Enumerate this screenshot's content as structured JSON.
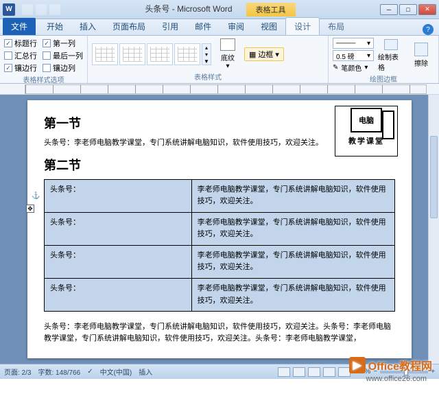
{
  "title": "头条号 - Microsoft Word",
  "contextTab": "表格工具",
  "tabs": {
    "file": "文件",
    "home": "开始",
    "insert": "插入",
    "layout": "页面布局",
    "references": "引用",
    "mailings": "邮件",
    "review": "审阅",
    "view": "视图",
    "design": "设计",
    "tblLayout": "布局"
  },
  "ribbon": {
    "options": {
      "headerRow": "标题行",
      "firstCol": "第一列",
      "totalRow": "汇总行",
      "lastCol": "最后一列",
      "bandedRow": "镶边行",
      "bandedCol": "镶边列",
      "groupLabel": "表格样式选项"
    },
    "styles": {
      "shading": "底纹",
      "border": "边框",
      "groupLabel": "表格样式"
    },
    "borders": {
      "weight": "0.5 磅",
      "penColor": "笔颜色",
      "draw": "绘制表格",
      "erase": "擦除",
      "groupLabel": "绘图边框"
    }
  },
  "doc": {
    "section1": "第一节",
    "para1": "头条号：李老师电脑教学课堂，专门系统讲解电脑知识，软件使用技巧，欢迎关注。",
    "section2": "第二节",
    "illus": {
      "line1": "电脑",
      "line2": "教学课堂"
    },
    "table": {
      "rows": [
        {
          "c1": "头条号：",
          "c2": "李老师电脑教学课堂，专门系统讲解电脑知识，软件使用技巧，欢迎关注。"
        },
        {
          "c1": "头条号：",
          "c2": "李老师电脑教学课堂，专门系统讲解电脑知识，软件使用技巧，欢迎关注。"
        },
        {
          "c1": "头条号：",
          "c2": "李老师电脑教学课堂，专门系统讲解电脑知识，软件使用技巧，欢迎关注。"
        },
        {
          "c1": "头条号：",
          "c2": "李老师电脑教学课堂，专门系统讲解电脑知识，软件使用技巧，欢迎关注。"
        }
      ]
    },
    "para2": "头条号：李老师电脑教学课堂，专门系统讲解电脑知识，软件使用技巧，欢迎关注。头条号：李老师电脑教学课堂，专门系统讲解电脑知识，软件使用技巧，欢迎关注。头条号：李老师电脑教学课堂，"
  },
  "status": {
    "page": "页面: 2/3",
    "words": "字数: 148/766",
    "lang": "中文(中国)",
    "mode": "插入",
    "zoom": "100%"
  },
  "watermark": {
    "brand": "Office教程网",
    "url": "www.office26.com"
  }
}
